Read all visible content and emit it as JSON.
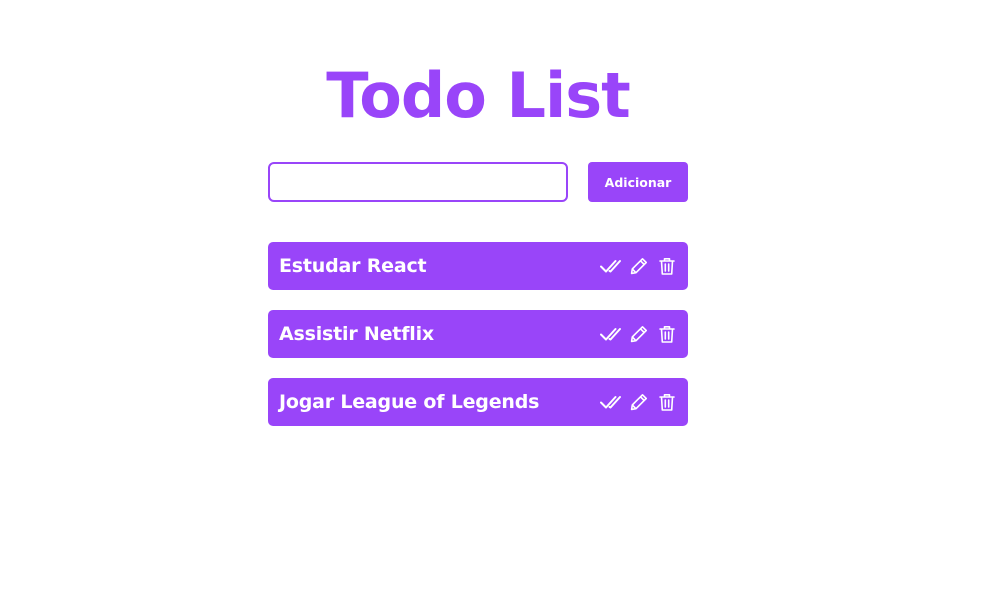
{
  "header": {
    "title": "Todo List"
  },
  "form": {
    "input_value": "",
    "input_placeholder": "",
    "add_label": "Adicionar"
  },
  "todos": [
    {
      "text": "Estudar React"
    },
    {
      "text": "Assistir Netflix"
    },
    {
      "text": "Jogar League of Legends"
    }
  ],
  "item_actions": [
    "check-icon",
    "pencil-icon",
    "trash-icon"
  ],
  "colors": {
    "accent": "#9945f9",
    "text_on_accent": "#ffffff",
    "background": "#ffffff"
  }
}
